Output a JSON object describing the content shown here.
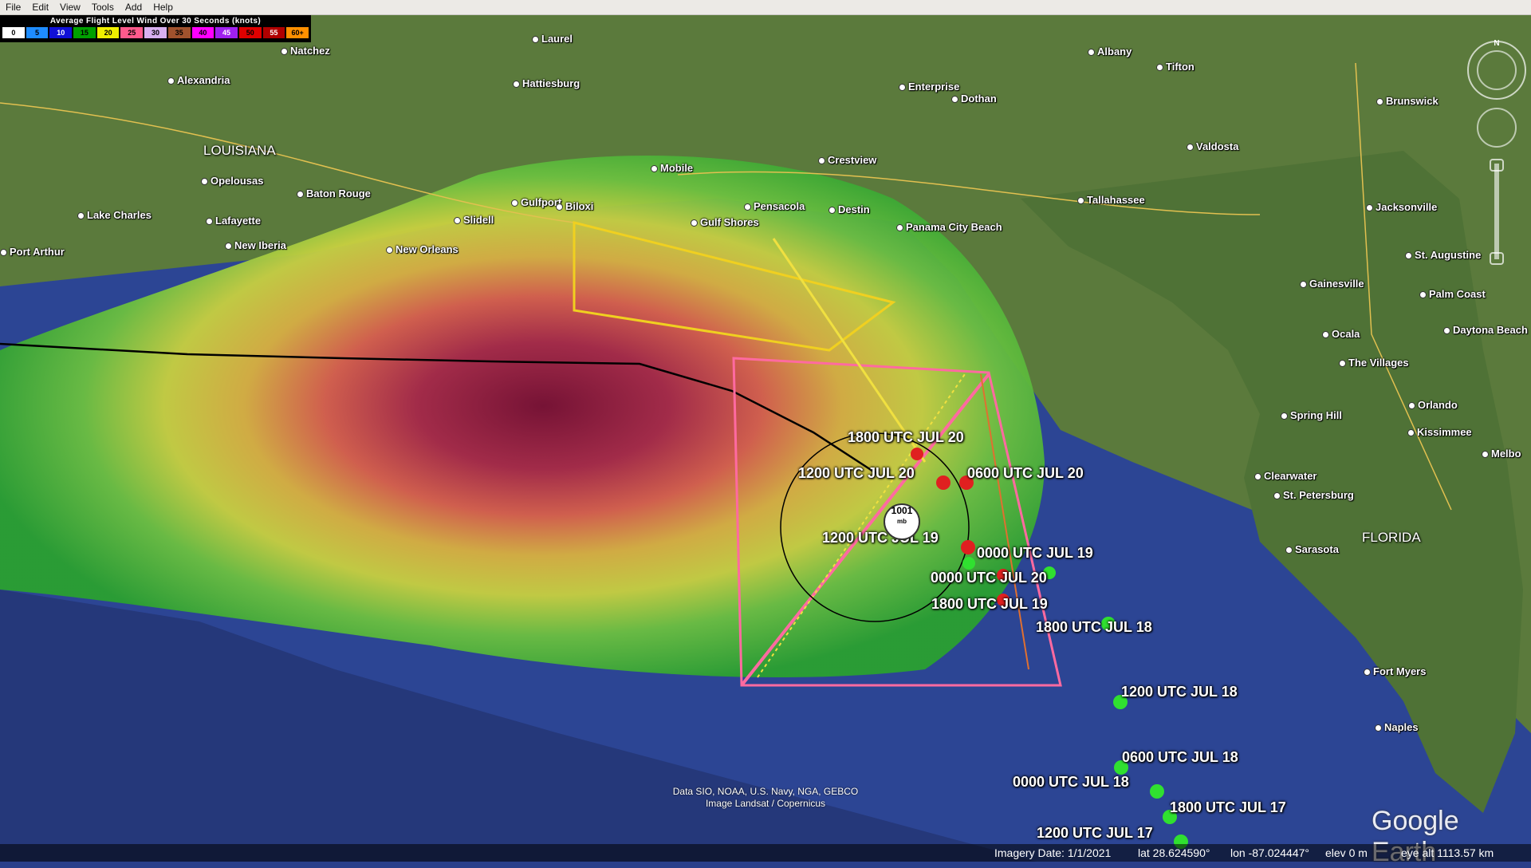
{
  "menu": [
    "File",
    "Edit",
    "View",
    "Tools",
    "Add",
    "Help"
  ],
  "legend": {
    "title": "Average Flight Level Wind Over 30 Seconds (knots)",
    "bins": [
      {
        "label": "0",
        "bg": "#ffffff",
        "fg": "#000000"
      },
      {
        "label": "5",
        "bg": "#1e8cff",
        "fg": "#000000"
      },
      {
        "label": "10",
        "bg": "#1010d8",
        "fg": "#ffffff"
      },
      {
        "label": "15",
        "bg": "#00a000",
        "fg": "#000000"
      },
      {
        "label": "20",
        "bg": "#f0f000",
        "fg": "#000000"
      },
      {
        "label": "25",
        "bg": "#ff5a8c",
        "fg": "#000000"
      },
      {
        "label": "30",
        "bg": "#d8b0f0",
        "fg": "#000000"
      },
      {
        "label": "35",
        "bg": "#a0522d",
        "fg": "#000000"
      },
      {
        "label": "40",
        "bg": "#ff00ff",
        "fg": "#000000"
      },
      {
        "label": "45",
        "bg": "#a020f0",
        "fg": "#ffffff"
      },
      {
        "label": "50",
        "bg": "#e00000",
        "fg": "#000000"
      },
      {
        "label": "55",
        "bg": "#b00000",
        "fg": "#ffffff"
      },
      {
        "label": "60+",
        "bg": "#ff9000",
        "fg": "#000000"
      }
    ]
  },
  "states": [
    "LOUISIANA",
    "FLORIDA"
  ],
  "cities": [
    "Natchez",
    "Laurel",
    "Albany",
    "Tifton",
    "Brunswick",
    "Alexandria",
    "Hattiesburg",
    "Enterprise",
    "Dothan",
    "Valdosta",
    "Crestview",
    "Mobile",
    "Opelousas",
    "Baton Rouge",
    "Gulfport",
    "Biloxi",
    "Pensacola",
    "Destin",
    "Tallahassee",
    "Jacksonville",
    "Lake Charles",
    "Lafayette",
    "Slidell",
    "Gulf Shores",
    "Panama City Beach",
    "New Iberia",
    "New Orleans",
    "St. Augustine",
    "Port Arthur",
    "Gainesville",
    "Palm Coast",
    "Daytona Beach",
    "Ocala",
    "The Villages",
    "Orlando",
    "Spring Hill",
    "Kissimmee",
    "Melbo",
    "Clearwater",
    "St. Petersburg",
    "Sarasota",
    "Fort Myers",
    "Naples"
  ],
  "track_labels": [
    "1800 UTC JUL 20",
    "1200 UTC JUL 20",
    "0600 UTC JUL 20",
    "1200 UTC JUL 19",
    "0000 UTC JUL 19",
    "0000 UTC JUL 20",
    "1800 UTC JUL 19",
    "1800 UTC JUL 18",
    "1200 UTC JUL 18",
    "0600 UTC JUL 18",
    "0000 UTC JUL 18",
    "1800 UTC JUL 17",
    "1200 UTC JUL 17"
  ],
  "pressure": {
    "value": "1001",
    "unit": "mb"
  },
  "attribution": [
    "Data SIO, NOAA, U.S. Navy, NGA, GEBCO",
    "Image Landsat / Copernicus"
  ],
  "logo": "Google Earth",
  "status": {
    "imagery_date": "Imagery Date: 1/1/2021",
    "lat": "lat   28.624590°",
    "lon": "lon  -87.024447°",
    "elev": "elev      0 m",
    "eye_alt": "eye alt 1113.57 km"
  },
  "north_label": "N"
}
